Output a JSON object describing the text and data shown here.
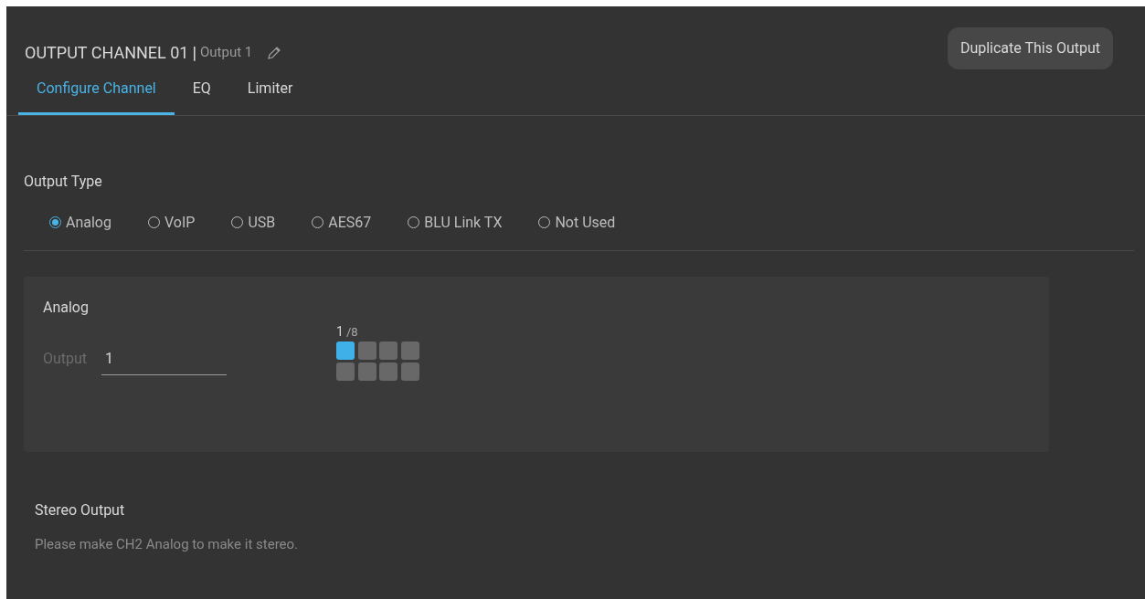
{
  "header": {
    "title": "OUTPUT CHANNEL 01",
    "separator": "|",
    "name": "Output 1"
  },
  "duplicate_button": "Duplicate This Output",
  "tabs": [
    {
      "label": "Configure Channel",
      "selected": true
    },
    {
      "label": "EQ",
      "selected": false
    },
    {
      "label": "Limiter",
      "selected": false
    }
  ],
  "output_type": {
    "label": "Output Type",
    "options": [
      {
        "label": "Analog",
        "selected": true
      },
      {
        "label": "VoIP",
        "selected": false
      },
      {
        "label": "USB",
        "selected": false
      },
      {
        "label": "AES67",
        "selected": false
      },
      {
        "label": "BLU Link TX",
        "selected": false
      },
      {
        "label": "Not Used",
        "selected": false
      }
    ]
  },
  "analog": {
    "title": "Analog",
    "field_label": "Output",
    "field_value": "1",
    "count": "1",
    "total": "/8",
    "slots": [
      {
        "selected": true
      },
      {
        "selected": false
      },
      {
        "selected": false
      },
      {
        "selected": false
      },
      {
        "selected": false
      },
      {
        "selected": false
      },
      {
        "selected": false
      },
      {
        "selected": false
      }
    ]
  },
  "stereo": {
    "title": "Stereo Output",
    "message": "Please make CH2 Analog to make it stereo."
  }
}
